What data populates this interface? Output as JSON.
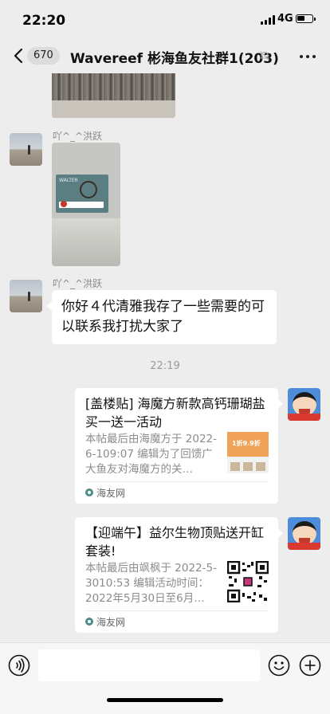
{
  "status_bar": {
    "time": "22:20",
    "network": "4G"
  },
  "header": {
    "unread_count": "670",
    "title": "Wavereef 彬海鱼友社群1(203)"
  },
  "messages": {
    "sender_name_1": "吖^_^洪跃",
    "sender_name_2": "吖^_^洪跃",
    "text_message": "你好４代清雅我存了一些需要的可以联系我打扰大家了",
    "timestamp": "22:19"
  },
  "cards": [
    {
      "title": "[盖楼贴] 海魔方新款高钙珊瑚盐买一送一活动",
      "desc": "本帖最后由海魔方于 2022-6-109:07 编辑为了回馈广大鱼友对海魔方的关…",
      "source": "海友网",
      "thumb_text": "1折9.9折"
    },
    {
      "title": "【迎端午】益尔生物顶贴送开缸套装!",
      "desc": "本帖最后由飒枫于 2022-5-3010:53 编辑活动时间：2022年5月30日至6月…",
      "source": "海友网"
    }
  ],
  "photo_text": {
    "box_label": "WALTER",
    "box_badge": "0"
  },
  "input": {
    "placeholder": ""
  },
  "colors": {
    "background": "#ededed",
    "bubble": "#ffffff",
    "accent": "#4c8c8a"
  }
}
